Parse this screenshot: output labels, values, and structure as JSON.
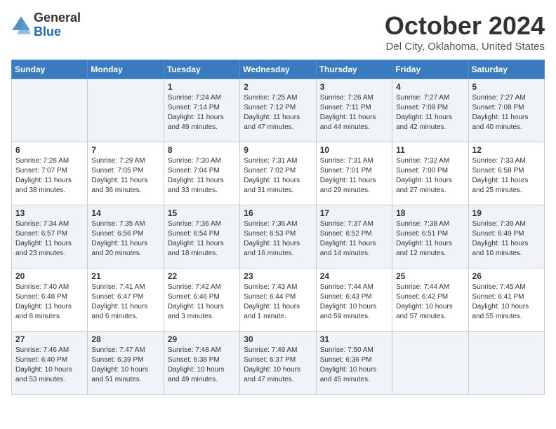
{
  "header": {
    "logo_general": "General",
    "logo_blue": "Blue",
    "month_title": "October 2024",
    "location": "Del City, Oklahoma, United States"
  },
  "weekdays": [
    "Sunday",
    "Monday",
    "Tuesday",
    "Wednesday",
    "Thursday",
    "Friday",
    "Saturday"
  ],
  "weeks": [
    [
      {
        "day": "",
        "info": ""
      },
      {
        "day": "",
        "info": ""
      },
      {
        "day": "1",
        "info": "Sunrise: 7:24 AM\nSunset: 7:14 PM\nDaylight: 11 hours and 49 minutes."
      },
      {
        "day": "2",
        "info": "Sunrise: 7:25 AM\nSunset: 7:12 PM\nDaylight: 11 hours and 47 minutes."
      },
      {
        "day": "3",
        "info": "Sunrise: 7:26 AM\nSunset: 7:11 PM\nDaylight: 11 hours and 44 minutes."
      },
      {
        "day": "4",
        "info": "Sunrise: 7:27 AM\nSunset: 7:09 PM\nDaylight: 11 hours and 42 minutes."
      },
      {
        "day": "5",
        "info": "Sunrise: 7:27 AM\nSunset: 7:08 PM\nDaylight: 11 hours and 40 minutes."
      }
    ],
    [
      {
        "day": "6",
        "info": "Sunrise: 7:28 AM\nSunset: 7:07 PM\nDaylight: 11 hours and 38 minutes."
      },
      {
        "day": "7",
        "info": "Sunrise: 7:29 AM\nSunset: 7:05 PM\nDaylight: 11 hours and 36 minutes."
      },
      {
        "day": "8",
        "info": "Sunrise: 7:30 AM\nSunset: 7:04 PM\nDaylight: 11 hours and 33 minutes."
      },
      {
        "day": "9",
        "info": "Sunrise: 7:31 AM\nSunset: 7:02 PM\nDaylight: 11 hours and 31 minutes."
      },
      {
        "day": "10",
        "info": "Sunrise: 7:31 AM\nSunset: 7:01 PM\nDaylight: 11 hours and 29 minutes."
      },
      {
        "day": "11",
        "info": "Sunrise: 7:32 AM\nSunset: 7:00 PM\nDaylight: 11 hours and 27 minutes."
      },
      {
        "day": "12",
        "info": "Sunrise: 7:33 AM\nSunset: 6:58 PM\nDaylight: 11 hours and 25 minutes."
      }
    ],
    [
      {
        "day": "13",
        "info": "Sunrise: 7:34 AM\nSunset: 6:57 PM\nDaylight: 11 hours and 23 minutes."
      },
      {
        "day": "14",
        "info": "Sunrise: 7:35 AM\nSunset: 6:56 PM\nDaylight: 11 hours and 20 minutes."
      },
      {
        "day": "15",
        "info": "Sunrise: 7:36 AM\nSunset: 6:54 PM\nDaylight: 11 hours and 18 minutes."
      },
      {
        "day": "16",
        "info": "Sunrise: 7:36 AM\nSunset: 6:53 PM\nDaylight: 11 hours and 16 minutes."
      },
      {
        "day": "17",
        "info": "Sunrise: 7:37 AM\nSunset: 6:52 PM\nDaylight: 11 hours and 14 minutes."
      },
      {
        "day": "18",
        "info": "Sunrise: 7:38 AM\nSunset: 6:51 PM\nDaylight: 11 hours and 12 minutes."
      },
      {
        "day": "19",
        "info": "Sunrise: 7:39 AM\nSunset: 6:49 PM\nDaylight: 11 hours and 10 minutes."
      }
    ],
    [
      {
        "day": "20",
        "info": "Sunrise: 7:40 AM\nSunset: 6:48 PM\nDaylight: 11 hours and 8 minutes."
      },
      {
        "day": "21",
        "info": "Sunrise: 7:41 AM\nSunset: 6:47 PM\nDaylight: 11 hours and 6 minutes."
      },
      {
        "day": "22",
        "info": "Sunrise: 7:42 AM\nSunset: 6:46 PM\nDaylight: 11 hours and 3 minutes."
      },
      {
        "day": "23",
        "info": "Sunrise: 7:43 AM\nSunset: 6:44 PM\nDaylight: 11 hours and 1 minute."
      },
      {
        "day": "24",
        "info": "Sunrise: 7:44 AM\nSunset: 6:43 PM\nDaylight: 10 hours and 59 minutes."
      },
      {
        "day": "25",
        "info": "Sunrise: 7:44 AM\nSunset: 6:42 PM\nDaylight: 10 hours and 57 minutes."
      },
      {
        "day": "26",
        "info": "Sunrise: 7:45 AM\nSunset: 6:41 PM\nDaylight: 10 hours and 55 minutes."
      }
    ],
    [
      {
        "day": "27",
        "info": "Sunrise: 7:46 AM\nSunset: 6:40 PM\nDaylight: 10 hours and 53 minutes."
      },
      {
        "day": "28",
        "info": "Sunrise: 7:47 AM\nSunset: 6:39 PM\nDaylight: 10 hours and 51 minutes."
      },
      {
        "day": "29",
        "info": "Sunrise: 7:48 AM\nSunset: 6:38 PM\nDaylight: 10 hours and 49 minutes."
      },
      {
        "day": "30",
        "info": "Sunrise: 7:49 AM\nSunset: 6:37 PM\nDaylight: 10 hours and 47 minutes."
      },
      {
        "day": "31",
        "info": "Sunrise: 7:50 AM\nSunset: 6:36 PM\nDaylight: 10 hours and 45 minutes."
      },
      {
        "day": "",
        "info": ""
      },
      {
        "day": "",
        "info": ""
      }
    ]
  ]
}
